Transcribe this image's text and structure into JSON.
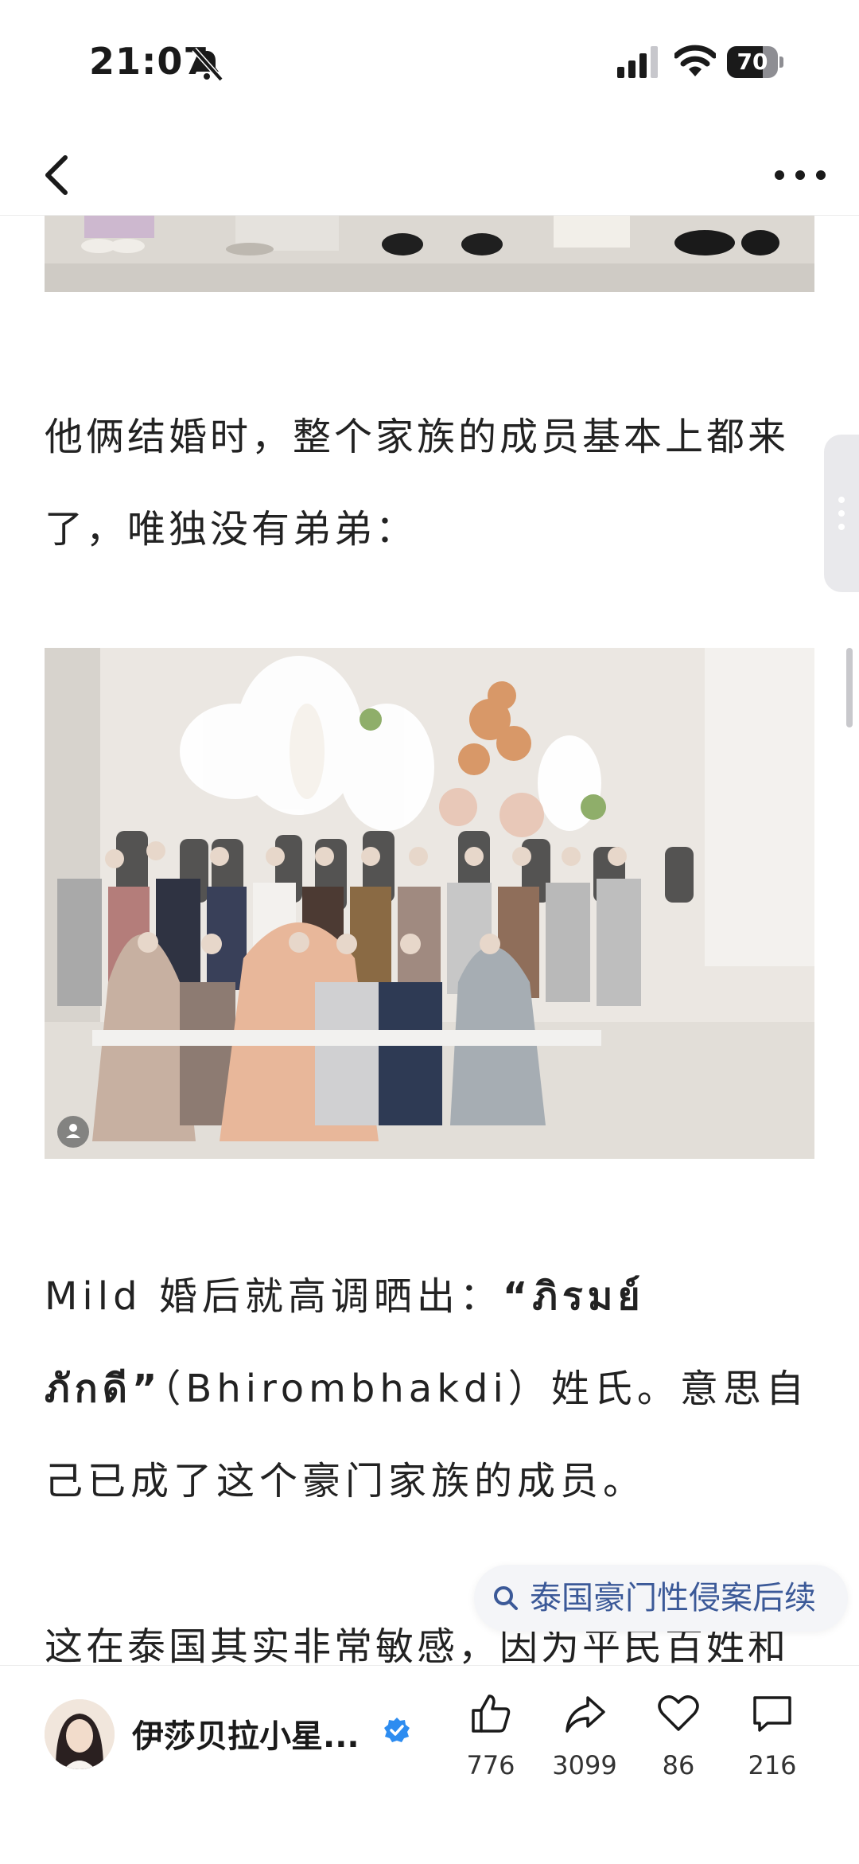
{
  "status_bar": {
    "time": "21:07",
    "battery": "70",
    "battery_level": 0.7
  },
  "article": {
    "para1": "他俩结婚时，整个家族的成员基本上都来了，唯独没有弟弟：",
    "para2_prefix": "Mild 婚后就高调晒出：",
    "para2_thai": "“ภิรมย์ภักดี”",
    "para2_suffix": "（Bhirombhakdi）姓氏。意思自己已成了这个豪门家族的成员。",
    "para3": "这在泰国其实非常敏感，因为平民百姓和高"
  },
  "search_chip": {
    "label": "泰国豪门性侵案后续",
    "icon": "search-icon"
  },
  "author": {
    "name": "伊莎贝拉小星..."
  },
  "actions": {
    "like_count": "776",
    "share_count": "3099",
    "favorite_count": "86",
    "comment_count": "216"
  },
  "colors": {
    "link": "#3b5998",
    "verified": "#2d8cf0",
    "text": "#222222"
  }
}
